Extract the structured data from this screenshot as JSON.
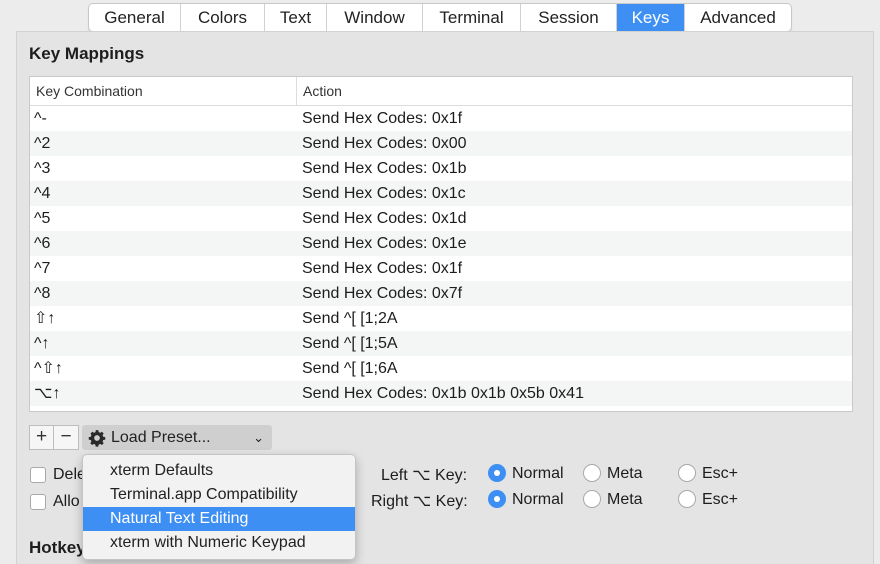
{
  "tabs": [
    {
      "label": "General",
      "active": false
    },
    {
      "label": "Colors",
      "active": false
    },
    {
      "label": "Text",
      "active": false
    },
    {
      "label": "Window",
      "active": false
    },
    {
      "label": "Terminal",
      "active": false
    },
    {
      "label": "Session",
      "active": false
    },
    {
      "label": "Keys",
      "active": true
    },
    {
      "label": "Advanced",
      "active": false
    }
  ],
  "section_title": "Key Mappings",
  "table": {
    "headers": [
      "Key Combination",
      "Action"
    ],
    "rows": [
      {
        "key": "^-",
        "action": "Send Hex Codes: 0x1f"
      },
      {
        "key": "^2",
        "action": "Send Hex Codes: 0x00"
      },
      {
        "key": "^3",
        "action": "Send Hex Codes: 0x1b"
      },
      {
        "key": "^4",
        "action": "Send Hex Codes: 0x1c"
      },
      {
        "key": "^5",
        "action": "Send Hex Codes: 0x1d"
      },
      {
        "key": "^6",
        "action": "Send Hex Codes: 0x1e"
      },
      {
        "key": "^7",
        "action": "Send Hex Codes: 0x1f"
      },
      {
        "key": "^8",
        "action": "Send Hex Codes: 0x7f"
      },
      {
        "key": "⇧↑",
        "action": "Send ^[ [1;2A"
      },
      {
        "key": "^↑",
        "action": "Send ^[ [1;5A"
      },
      {
        "key": "^⇧↑",
        "action": "Send ^[ [1;6A"
      },
      {
        "key": "⌥↑",
        "action": "Send Hex Codes: 0x1b 0x1b 0x5b 0x41"
      }
    ]
  },
  "controls": {
    "add_label": "+",
    "remove_label": "−",
    "load_preset_label": "Load Preset...",
    "chevron": "⌄"
  },
  "checkboxes": [
    {
      "label": "Dele",
      "checked": false
    },
    {
      "label": "Allo",
      "checked": false
    }
  ],
  "preset_menu": {
    "items": [
      {
        "label": "xterm Defaults",
        "highlighted": false
      },
      {
        "label": "Terminal.app Compatibility",
        "highlighted": false
      },
      {
        "label": "Natural Text Editing",
        "highlighted": true
      },
      {
        "label": "xterm with Numeric Keypad",
        "highlighted": false
      }
    ]
  },
  "option_keys": {
    "left_label": "Left ⌥ Key:",
    "right_label": "Right ⌥ Key:",
    "choices": [
      "Normal",
      "Meta",
      "Esc+"
    ],
    "left_selected": "Normal",
    "right_selected": "Normal"
  },
  "hotkeys_title": "Hotkeys",
  "colors": {
    "accent": "#3e8ff3"
  }
}
